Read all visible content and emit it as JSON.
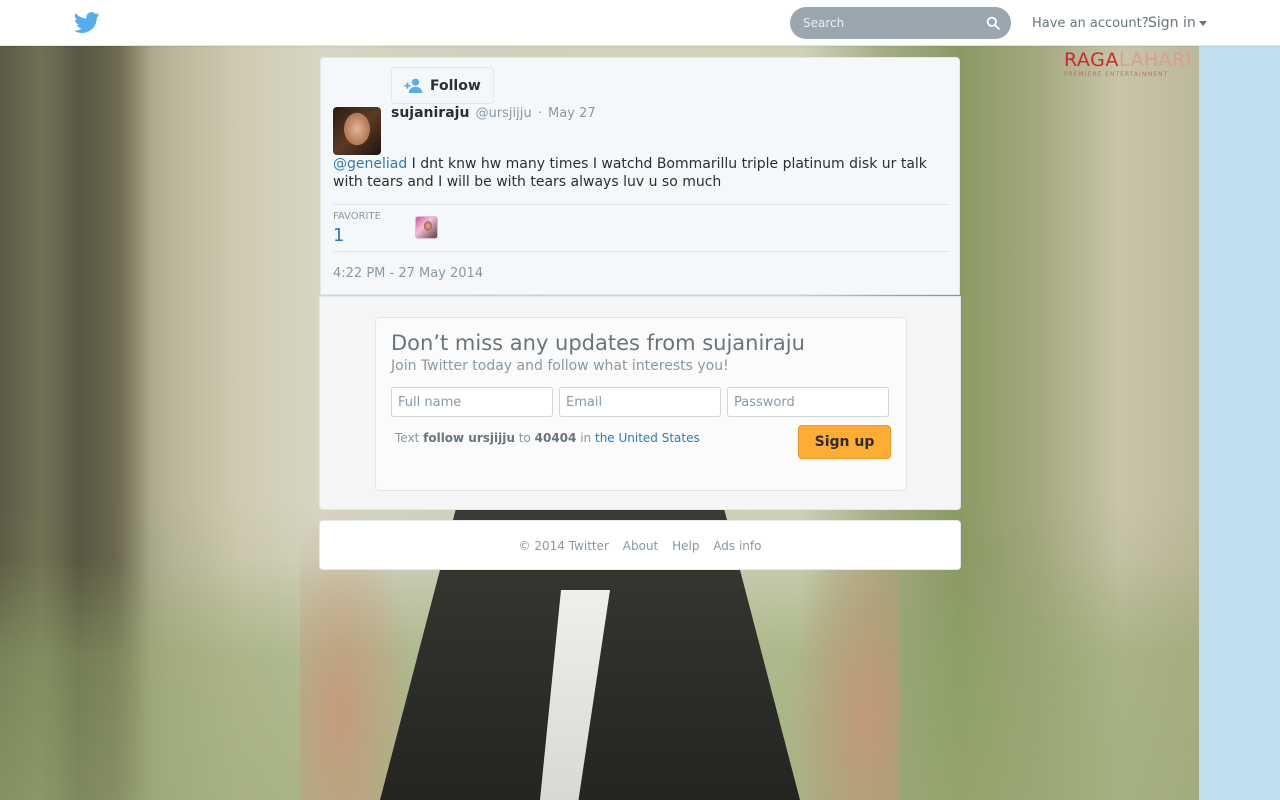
{
  "colors": {
    "twitter_blue": "#55acee",
    "link": "#2b7bb9",
    "signup_button": "#ffac33",
    "page_background": "#c0deed"
  },
  "header": {
    "logo_icon": "twitter-bird-icon",
    "search_placeholder": "Search",
    "search_icon": "magnifier-icon",
    "have_account": "Have an account?",
    "sign_in": "Sign in"
  },
  "watermark": {
    "brand_part1": "RAGA",
    "brand_part2": "LAHARI",
    "tagline": "PREMIERE ENTERTAINMENT"
  },
  "tweet": {
    "follow_label": "Follow",
    "fullname": "sujaniraju",
    "username": "@ursjijju",
    "separator": "·",
    "date": "May 27",
    "mention": "@geneliad",
    "text": " I dnt knw hw many times I watchd Bommarillu triple platinum disk ur talk with tears and I will be with tears always luv u so much",
    "favorite_label": "FAVORITE",
    "favorite_count": "1",
    "timestamp": "4:22 PM - 27 May 2014"
  },
  "signup": {
    "title": "Don’t miss any updates from sujaniraju",
    "subtitle": "Join Twitter today and follow what interests you!",
    "fullname_placeholder": "Full name",
    "email_placeholder": "Email",
    "password_placeholder": "Password",
    "sms_prefix": "Text",
    "sms_command": "follow ursjijju",
    "sms_to": "to",
    "sms_number": "40404",
    "sms_in": "in",
    "sms_country": "the United States",
    "button": "Sign up"
  },
  "footer": {
    "copyright": "© 2014 Twitter",
    "links": [
      "About",
      "Help",
      "Ads info"
    ]
  }
}
